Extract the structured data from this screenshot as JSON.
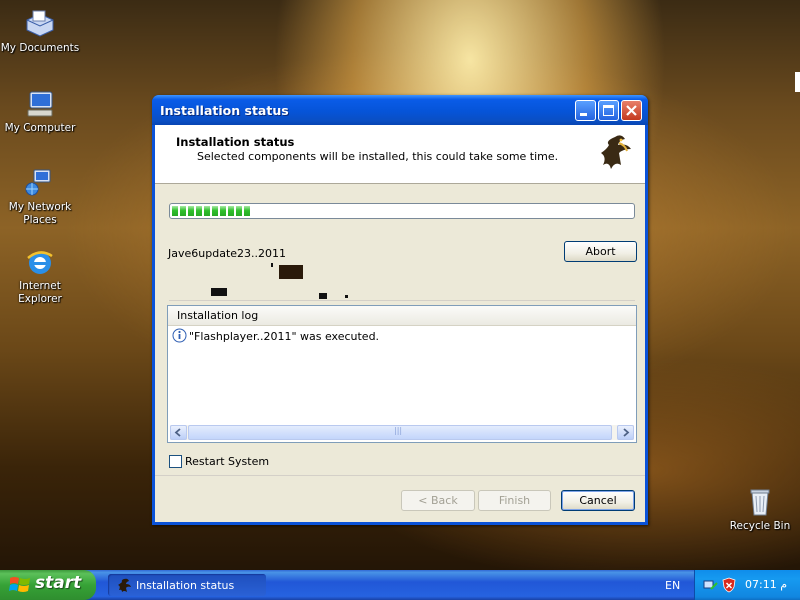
{
  "desktop": {
    "icons": [
      {
        "label": "My Documents",
        "icon": "my-documents-icon"
      },
      {
        "label": "My Computer",
        "icon": "my-computer-icon"
      },
      {
        "label": "My Network Places",
        "icon": "network-places-icon"
      },
      {
        "label": "Internet Explorer",
        "icon": "internet-explorer-icon"
      },
      {
        "label": "Recycle Bin",
        "icon": "recycle-bin-icon"
      }
    ]
  },
  "window": {
    "title": "Installation status",
    "header_title": "Installation status",
    "header_subtitle": "Selected components will be installed, this could take some time.",
    "progress_percent": 17,
    "status_text": "Jave6update23..2011",
    "abort_label": "Abort",
    "log": {
      "header": "Installation log",
      "entries": [
        "\"Flashplayer..2011\" was executed."
      ]
    },
    "scroll_thumb_glyph": "|||",
    "restart_label": "Restart System",
    "restart_checked": false,
    "back_label": "< Back",
    "finish_label": "Finish",
    "cancel_label": "Cancel"
  },
  "taskbar": {
    "start_label": "start",
    "task_label": "Installation status",
    "language": "EN",
    "clock": "07:11 م"
  },
  "colors": {
    "titlebar_blue": "#0a5ce8",
    "start_green": "#36a236",
    "progress_green": "#2fbf2c"
  }
}
